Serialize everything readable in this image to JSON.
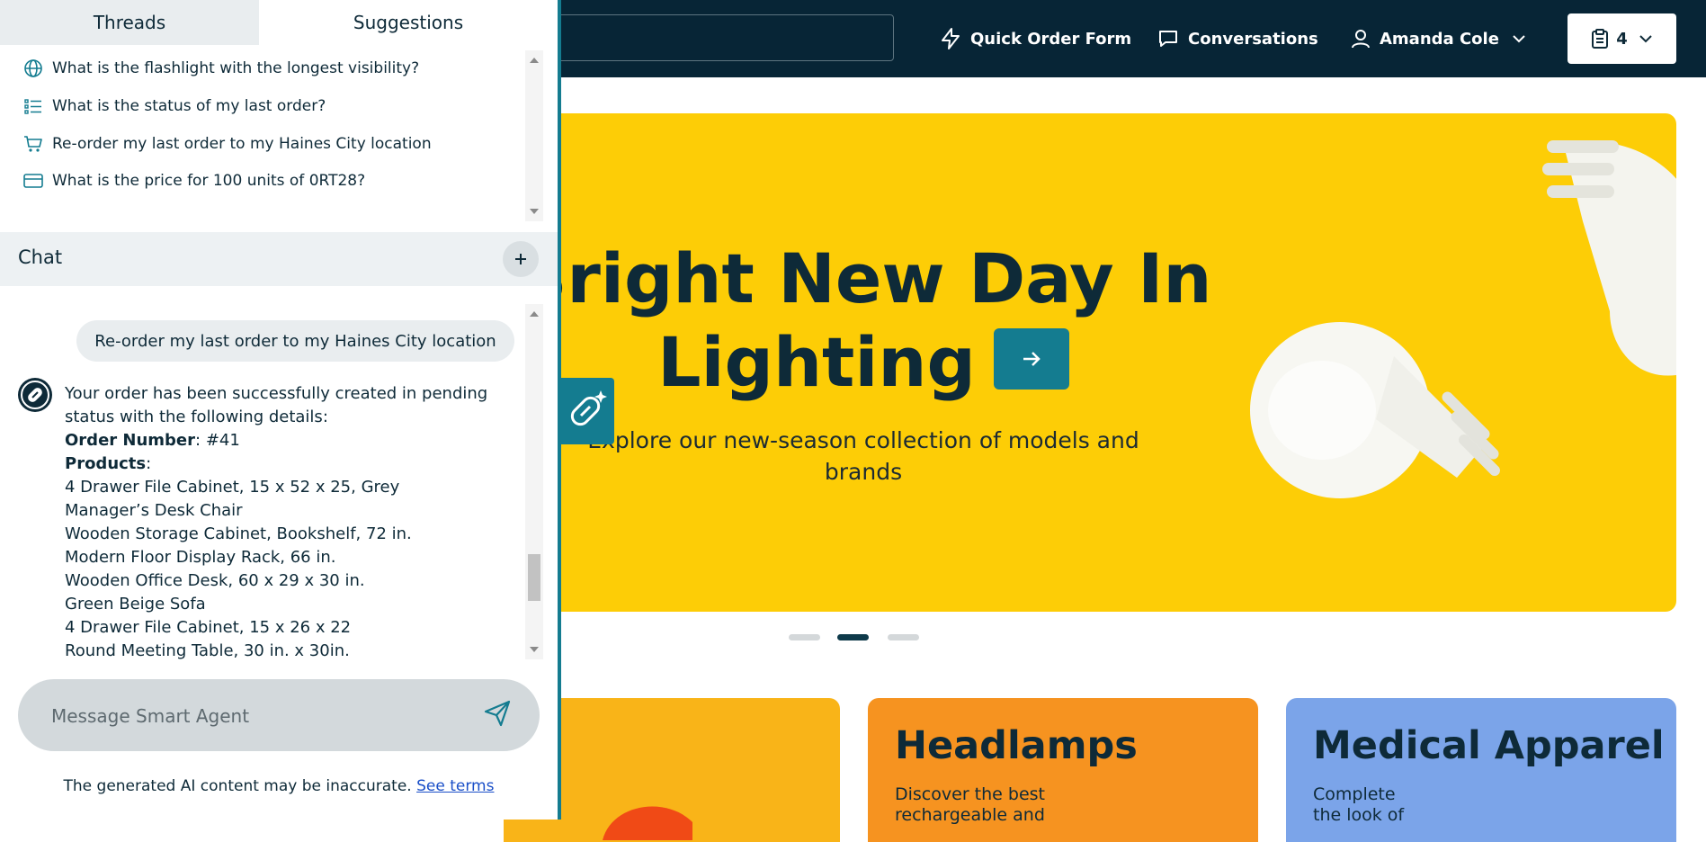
{
  "panel": {
    "tabs": [
      {
        "label": "Threads"
      },
      {
        "label": "Suggestions"
      }
    ],
    "suggestions": [
      {
        "icon": "globe-icon",
        "text": "What is the flashlight with the longest visibility?"
      },
      {
        "icon": "list-icon",
        "text": "What is the status of my last order?"
      },
      {
        "icon": "cart-icon",
        "text": "Re-order my last order to my Haines City location"
      },
      {
        "icon": "card-icon",
        "text": "What is the price for 100 units of 0RT28?"
      }
    ],
    "chat_title": "Chat",
    "messages": {
      "user": "Re-order my last order to my Haines City location",
      "bot_intro_1": "Your order has been successfully created in pending",
      "bot_intro_2": "status with the following details:",
      "order_number_label": "Order Number",
      "order_number_value": ": #41",
      "products_label": "Products",
      "products_colon": ":",
      "products": [
        "4 Drawer File Cabinet, 15 x 52 x 25, Grey",
        "Manager’s Desk Chair",
        "Wooden Storage Cabinet, Bookshelf, 72 in.",
        "Modern Floor Display Rack, 66 in.",
        "Wooden Office Desk, 60 x 29 x 30 in.",
        "Green Beige Sofa",
        "4 Drawer File Cabinet, 15 x 26 x 22",
        "Round Meeting Table, 30 in. x 30in."
      ]
    },
    "composer": {
      "placeholder": "Message Smart Agent"
    },
    "disclaimer": {
      "text": "The generated AI content may be inaccurate. ",
      "link": "See terms"
    }
  },
  "header": {
    "quick_order": "Quick Order Form",
    "conversations": "Conversations",
    "user": "Amanda Cole",
    "cart_count": "4"
  },
  "hero": {
    "title_line1": "Bright New Day In",
    "title_line2": "Lighting",
    "subtitle": "Explore our new-season collection of models and brands",
    "active_slide": 2,
    "slide_count": 3
  },
  "categories": [
    {
      "title": "",
      "desc": ""
    },
    {
      "title": "Headlamps",
      "desc": "Discover the best rechargeable and"
    },
    {
      "title": "Medical Apparel",
      "desc": "Complete the look of"
    }
  ],
  "colors": {
    "header_bg": "#072536",
    "accent": "#147c90",
    "hero_bg": "#fdcd06",
    "card_orange": "#f69320",
    "card_yellow": "#f9b418",
    "card_blue": "#7ba4e9"
  }
}
